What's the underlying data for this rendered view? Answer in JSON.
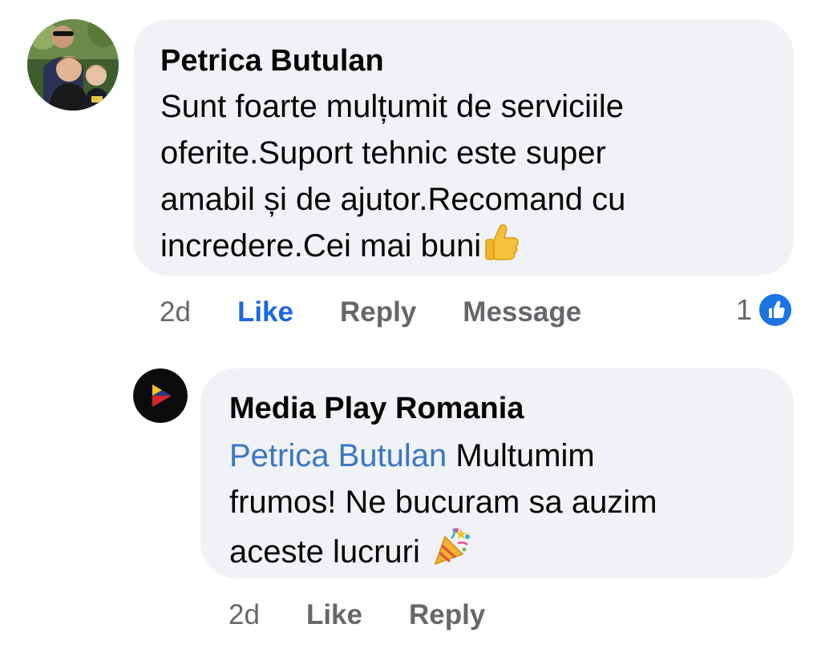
{
  "comment": {
    "author": "Petrica Butulan",
    "text": "Sunt foarte mulțumit de serviciile\noferite.Suport tehnic este super\namabil și de ajutor.Recomand cu\nincredere.Cei mai buni",
    "emoji": "thumbs-up-icon",
    "time": "2d",
    "like_label": "Like",
    "reply_label": "Reply",
    "message_label": "Message",
    "reaction_count": "1",
    "like_active": true
  },
  "reply": {
    "author": "Media Play Romania",
    "mention": "Petrica Butulan",
    "text_line1": "Multumim",
    "text_rest": "frumos! Ne bucuram sa auzim\naceste lucruri",
    "emoji": "party-popper-icon",
    "time": "2d",
    "like_label": "Like",
    "reply_label": "Reply"
  },
  "colors": {
    "bubble": "#f0f2f5",
    "link_blue": "#1b66e8",
    "mention_blue": "#3a76c4",
    "muted_gray": "#65676b"
  }
}
